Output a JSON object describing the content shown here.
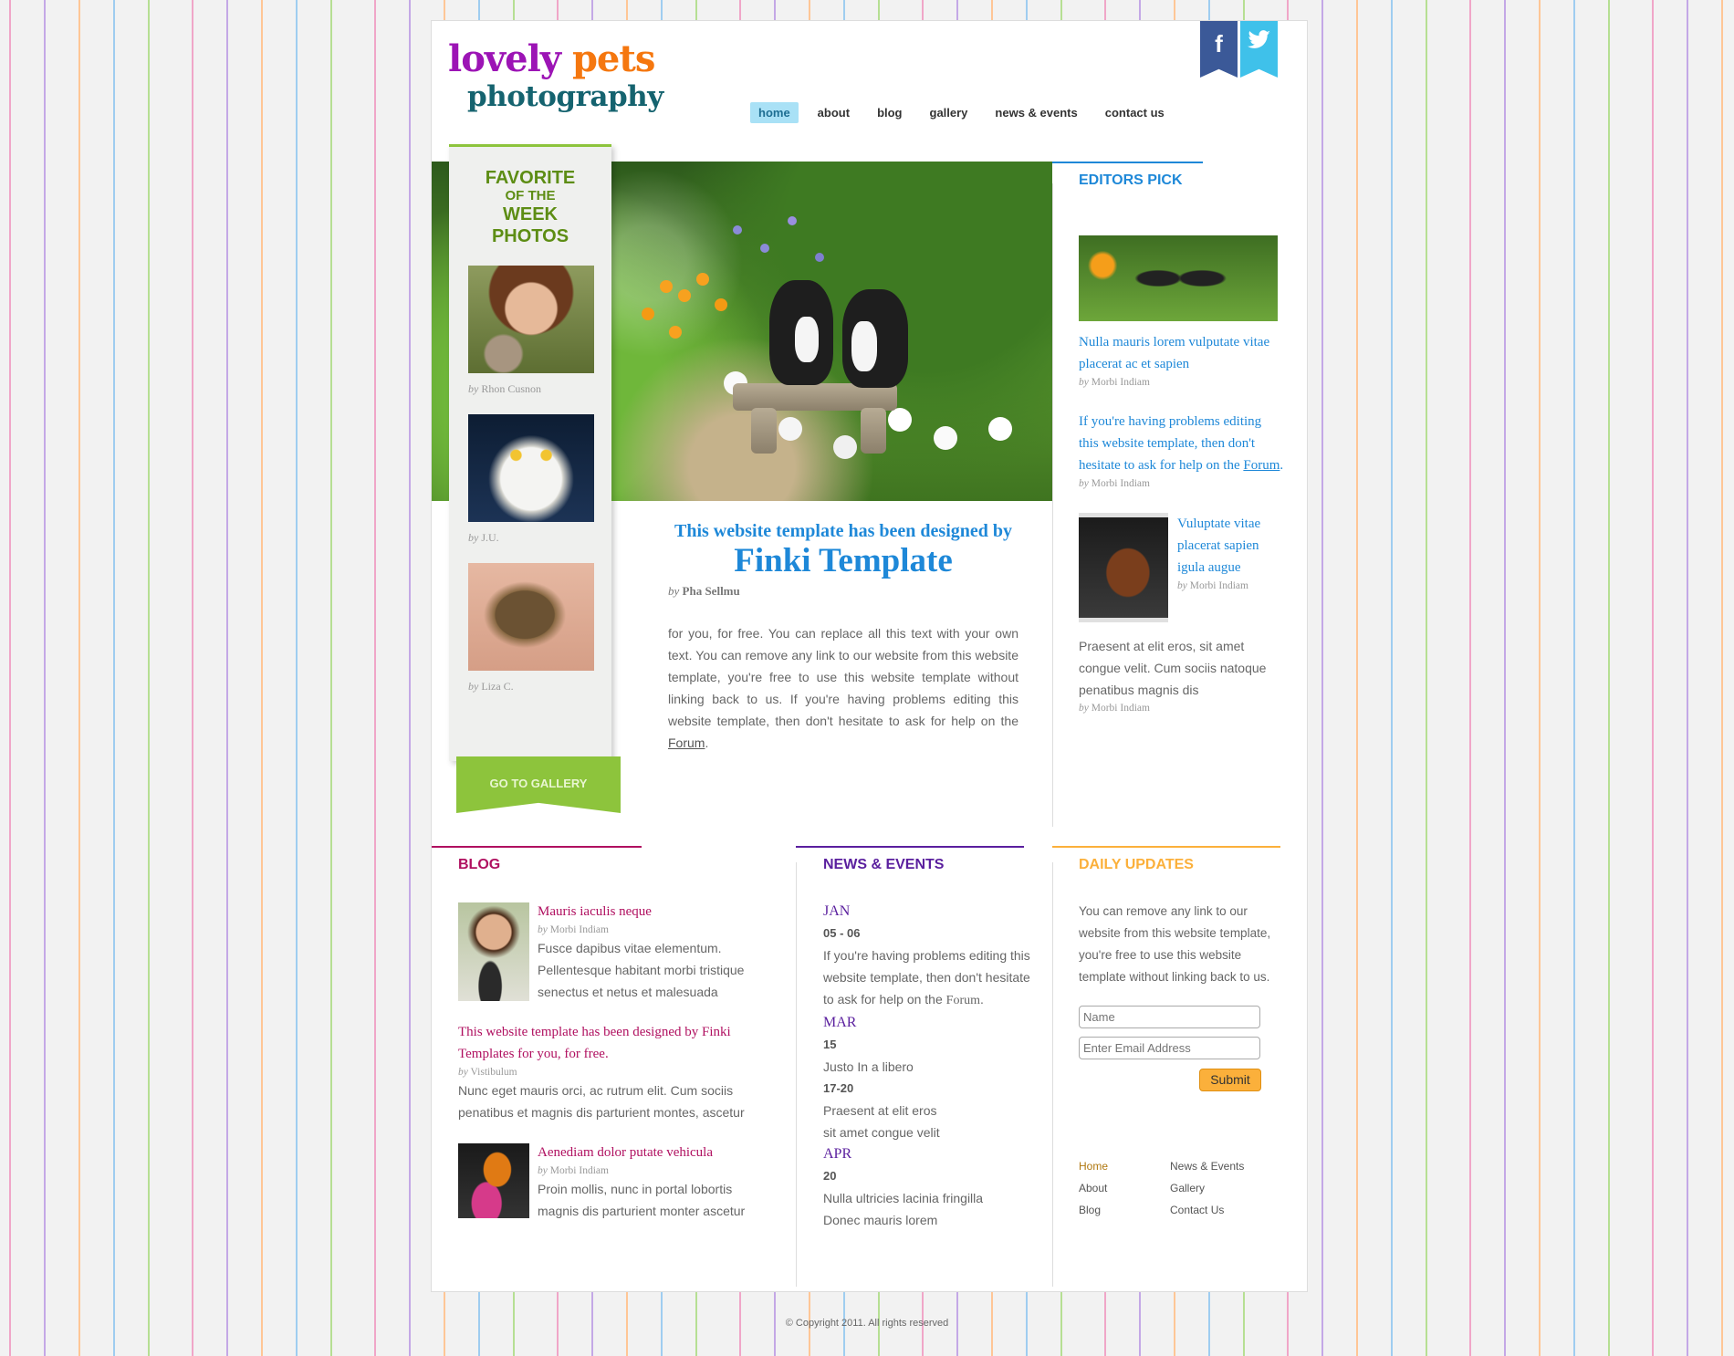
{
  "logo": {
    "word1": "lovely",
    "word2": "pets",
    "word3": "photography"
  },
  "social": {
    "facebook_glyph": "f",
    "twitter_glyph": "twitter-bird"
  },
  "nav": {
    "items": [
      {
        "label": "home",
        "active": true
      },
      {
        "label": "about"
      },
      {
        "label": "blog"
      },
      {
        "label": "gallery"
      },
      {
        "label": "news & events"
      },
      {
        "label": "contact us"
      }
    ]
  },
  "favorites": {
    "title1": "FAVORITE",
    "title2": "OF THE",
    "title3": "WEEK",
    "title4": "PHOTOS",
    "items": [
      {
        "by": "by",
        "author": "Rhon Cusnon"
      },
      {
        "by": "by",
        "author": "J.U."
      },
      {
        "by": "by",
        "author": "Liza C."
      }
    ],
    "gallery_button": "GO TO GALLERY"
  },
  "article": {
    "title1": "This website template has been designed by",
    "title2": "Finki Template",
    "by": "by",
    "author": "Pha Sellmu",
    "body": "for you, for free. You can replace all this text with your own text. You can remove any link to our website from this website template, you're free to use this website template without linking back to us. If you're having problems editing this website template, then don't hesitate to ask for help on the",
    "link": "Forum",
    "end": "."
  },
  "editors_pick": {
    "heading": "EDITORS PICK",
    "item1": {
      "title": "Nulla mauris lorem vulputate vitae placerat ac et sapien",
      "by": "by",
      "author": "Morbi Indiam"
    },
    "item2": {
      "text": "If you're having problems editing this website template, then don't hesitate to ask for help on the",
      "link": "Forum",
      "end": ".",
      "by": "by",
      "author": "Morbi Indiam"
    },
    "item3": {
      "title": "Vuluptate vitae placerat sapien igula augue",
      "by": "by",
      "author": "Morbi Indiam"
    },
    "item4": {
      "text": "Praesent at elit eros, sit amet congue velit. Cum sociis natoque penatibus magnis dis",
      "by": "by",
      "author": "Morbi Indiam"
    }
  },
  "blog": {
    "heading": "BLOG",
    "post1": {
      "title": "Mauris iaculis neque",
      "by": "by",
      "author": "Morbi Indiam",
      "text": "Fusce dapibus vitae elementum. Pellentesque habitant morbi tristique senectus et netus et malesuada"
    },
    "post2": {
      "title": "This website template has been designed by Finki Templates for you, for free.",
      "by": "by",
      "author": "Vistibulum",
      "text": "Nunc eget mauris orci, ac rutrum elit. Cum sociis penatibus et magnis dis parturient montes, ascetur"
    },
    "post3": {
      "title": "Aenediam dolor putate vehicula",
      "by": "by",
      "author": "Morbi Indiam",
      "text": "Proin mollis, nunc in portal lobortis magnis dis parturient monter ascetur"
    }
  },
  "news": {
    "heading": "NEWS & EVENTS",
    "m1": "JAN",
    "d1": "05 - 06",
    "t1": "If you're having problems editing this website template, then don't hesitate to ask for help on the",
    "t1link": "Forum",
    "t1end": ".",
    "m2": "MAR",
    "d2": "15",
    "t2": "Justo In a libero",
    "d3": "17-20",
    "t3a": "Praesent at elit eros",
    "t3b": "sit amet congue velit",
    "m3": "APR",
    "d4": "20",
    "t4a": "Nulla ultricies lacinia fringilla",
    "t4b": "Donec mauris lorem"
  },
  "daily": {
    "heading": "DAILY UPDATES",
    "text": "You can remove any link to our website from this website template, you're free to use this website template without linking back to us.",
    "name_placeholder": "Name",
    "email_placeholder": "Enter Email Address",
    "submit": "Submit"
  },
  "footer_links": {
    "home": "Home",
    "news": "News & Events",
    "about": "About",
    "gallery": "Gallery",
    "blog": "Blog",
    "contact": "Contact Us"
  },
  "copyright": "© Copyright 2011. All rights reserved",
  "colors": {
    "blue": "#1e88d8",
    "green": "#8dc43c",
    "magenta": "#b01060",
    "purple": "#5a1f9e",
    "orange": "#fbb03b"
  }
}
